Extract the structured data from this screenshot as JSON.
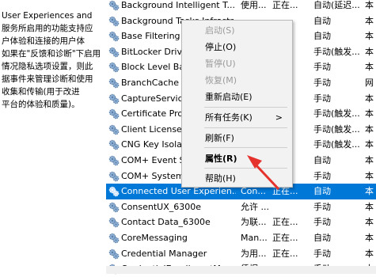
{
  "description_panel": {
    "lines": [
      "User Experiences and",
      "服务所启用的功能支持应",
      "户体验和连接的用户体",
      "如果在\"反馈和诊断\"下启用",
      "情况隐私选项设置，则此",
      "据事件来管理诊断和使用",
      "收集和传输(用于改进",
      "平台的体验和质量)。"
    ]
  },
  "services": [
    {
      "name": "Background Intelligent T...",
      "desc": "使用...",
      "status": "正在...",
      "startup": "自动(延迟...",
      "logon": "本"
    },
    {
      "name": "Background Tasks Infrastr...",
      "desc": "",
      "status": "",
      "startup": "自动",
      "logon": "本"
    },
    {
      "name": "Base Filtering Engine",
      "desc": "",
      "status": "",
      "startup": "自动",
      "logon": "本"
    },
    {
      "name": "BitLocker Drive Encryption",
      "desc": "",
      "status": "",
      "startup": "手动(触发...",
      "logon": "本"
    },
    {
      "name": "Block Level Backup Engine",
      "desc": "",
      "status": "",
      "startup": "手动",
      "logon": "本"
    },
    {
      "name": "BranchCache",
      "desc": "",
      "status": "",
      "startup": "手动",
      "logon": "网"
    },
    {
      "name": "CaptureService",
      "desc": "",
      "status": "",
      "startup": "手动",
      "logon": "本"
    },
    {
      "name": "Certificate Propagation",
      "desc": "",
      "status": "",
      "startup": "手动(触发...",
      "logon": "本"
    },
    {
      "name": "Client License Service",
      "desc": "",
      "status": "",
      "startup": "手动(触发...",
      "logon": "本"
    },
    {
      "name": "CNG Key Isolation",
      "desc": "",
      "status": "",
      "startup": "手动(触发...",
      "logon": "本"
    },
    {
      "name": "COM+ Event System",
      "desc": "",
      "status": "",
      "startup": "自动",
      "logon": "本"
    },
    {
      "name": "COM+ System Application",
      "desc": "",
      "status": "",
      "startup": "手动",
      "logon": "本"
    },
    {
      "name": "Connected User Experien...",
      "desc": "Con...",
      "status": "正在...",
      "startup": "自动",
      "logon": "本",
      "selected": true
    },
    {
      "name": "ConsentUX_6300e",
      "desc": "允许 ...",
      "status": "",
      "startup": "手动",
      "logon": "本"
    },
    {
      "name": "Contact Data_6300e",
      "desc": "为联...",
      "status": "正在...",
      "startup": "手动",
      "logon": "本"
    },
    {
      "name": "CoreMessaging",
      "desc": "Man...",
      "status": "正在...",
      "startup": "自动",
      "logon": "本"
    },
    {
      "name": "Credential Manager",
      "desc": "为用...",
      "status": "正在...",
      "startup": "手动",
      "logon": "本"
    },
    {
      "name": "CredentialEnrollmentMan...",
      "desc": "凭据...",
      "status": "",
      "startup": "手动",
      "logon": "本"
    }
  ],
  "context_menu": {
    "items": [
      {
        "label": "启动(S)",
        "disabled": true
      },
      {
        "label": "停止(O)",
        "disabled": false
      },
      {
        "label": "暂停(U)",
        "disabled": true
      },
      {
        "label": "恢复(M)",
        "disabled": true
      },
      {
        "label": "重新启动(E)",
        "disabled": false
      },
      {
        "label": "所有任务(K)",
        "disabled": false,
        "submenu": true
      },
      {
        "label": "刷新(F)",
        "disabled": false
      },
      {
        "label": "属性(R)",
        "disabled": false,
        "bold": true
      },
      {
        "label": "帮助(H)",
        "disabled": false
      }
    ],
    "arrow_glyph": ">"
  },
  "colors": {
    "selection": "#0078d7",
    "annotation_arrow": "#e5322d",
    "menu_bg": "#f2f2f2"
  },
  "icons": {
    "service": "gear-icon",
    "annotation": "red-arrow-annotation"
  }
}
